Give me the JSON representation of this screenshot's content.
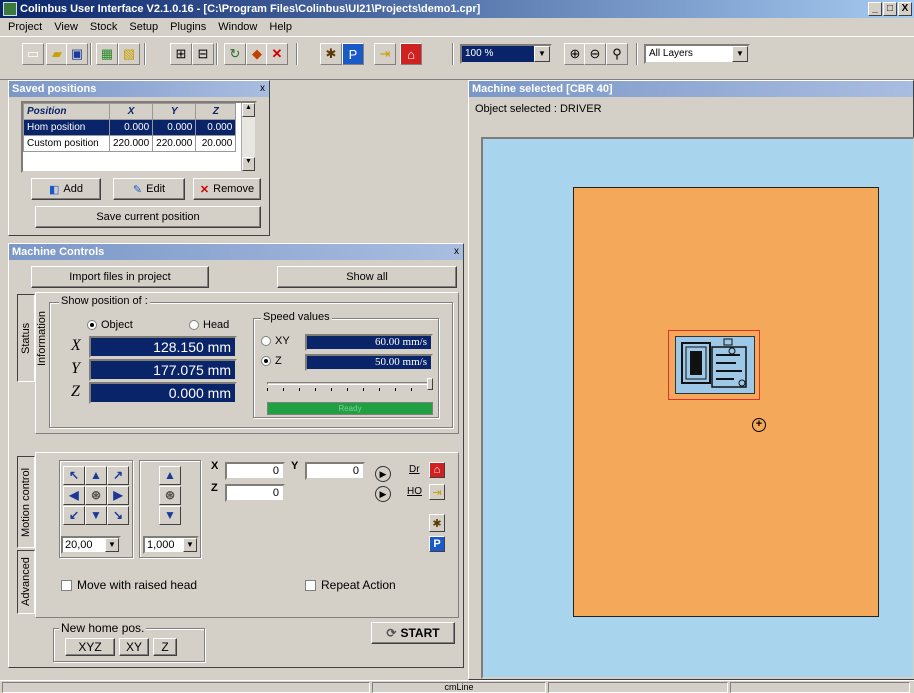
{
  "window": {
    "title": "Colinbus User Interface V2.1.0.16 - [C:\\Program Files\\Colinbus\\UI21\\Projects\\demo1.cpr]",
    "min": "_",
    "max": "□",
    "close": "X"
  },
  "menu": [
    "Project",
    "View",
    "Stock",
    "Setup",
    "Plugins",
    "Window",
    "Help"
  ],
  "toolbar": {
    "zoom_value": "100 %",
    "layers_value": "All Layers"
  },
  "saved_positions": {
    "title": "Saved positions",
    "close": "x",
    "columns": [
      "Position",
      "X",
      "Y",
      "Z"
    ],
    "rows": [
      {
        "name": "Hom position",
        "x": "0.000",
        "y": "0.000",
        "z": "0.000"
      },
      {
        "name": "Custom position",
        "x": "220.000",
        "y": "220.000",
        "z": "20.000"
      }
    ],
    "add_label": "Add",
    "edit_label": "Edit",
    "remove_label": "Remove",
    "save_current_label": "Save current position"
  },
  "machine_controls": {
    "title": "Machine Controls",
    "close": "x",
    "import_label": "Import files in project",
    "show_all_label": "Show all",
    "tab_status": "Status Information",
    "tab_motion": "Motion control",
    "tab_advanced": "Advanced",
    "show_position_label": "Show position of :",
    "object_label": "Object",
    "head_label": "Head",
    "x_label": "X",
    "y_label": "Y",
    "z_label": "Z",
    "x_value": "128.150 mm",
    "y_value": "177.075 mm",
    "z_value": "0.000 mm",
    "speed_label": "Speed values",
    "speed_xy_label": "XY",
    "speed_z_label": "Z",
    "speed_xy": "60.00 mm/s",
    "speed_z": "50.00 mm/s",
    "ready_label": "Ready",
    "ready_progress": 1.0,
    "step_select": "20,00",
    "z_step_select": "1,000",
    "target_x_label": "X",
    "target_y_label": "Y",
    "target_z_label": "Z",
    "target_x": "0",
    "target_y": "0",
    "target_z": "0",
    "dr_label": "Dr",
    "ho_label": "HO",
    "move_raised_label": "Move with raised head",
    "repeat_label": "Repeat Action",
    "new_home_label": "New home pos.",
    "xyz_label": "XYZ",
    "xy_label": "XY",
    "z_btn_label": "Z",
    "start_label": "START"
  },
  "canvas": {
    "title": "Machine selected [CBR 40]",
    "object_selected": "Object selected : DRIVER",
    "bg_color": "#a8d4ee",
    "stock_color": "#f3a85a"
  },
  "status": {
    "pane_text": "cmLine"
  }
}
